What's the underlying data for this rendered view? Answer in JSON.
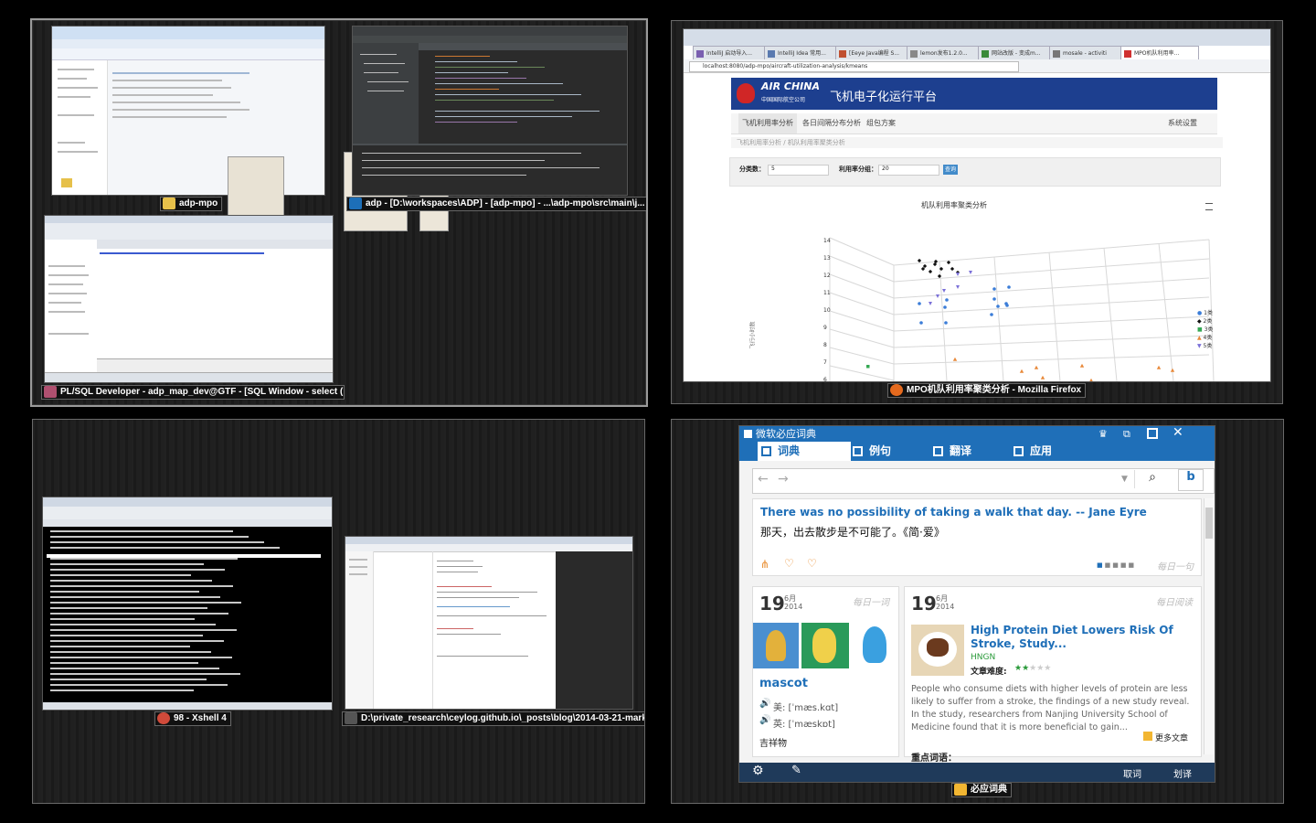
{
  "labels": {
    "explorer": "adp-mpo",
    "idea": "adp - [D:\\workspaces\\ADP] - [adp-mpo] - ...\\adp-mpo\\src\\main\\j...",
    "plsql": "PL/SQL Developer - adp_map_dev@GTF - [SQL Window - select (ma...",
    "firefox": "MPO机队利用率聚类分析 - Mozilla Firefox",
    "xshell": "98 - Xshell 4",
    "editor": "D:\\private_research\\ceylog.github.io\\_posts\\blog\\2014-03-21-mark-...",
    "dict": "必应词典"
  },
  "firefox": {
    "tabs": [
      "IntelliJ 启动导入...",
      "IntelliJ Idea 常用...",
      "[Eeye Java编程 S...",
      "lemon发布1.2.0...",
      "网站改版 - 变成m...",
      "mosale - activiti",
      "MPO机队利用率..."
    ],
    "url": "localhost:8080/adp-mpo/aircraft-utilization-analysis/kmeans",
    "airline": "AIR CHINA",
    "airline_cn": "中国国际航空公司",
    "platform": "飞机电子化运行平台",
    "nav": [
      "飞机利用率分析",
      "各日间隔分布分析",
      "组包方案"
    ],
    "settings": "系统设置",
    "breadcrumb": [
      "飞机利用率分析",
      "机队利用率聚类分析"
    ],
    "form": {
      "k_label": "分类数：",
      "k_value": "5",
      "group_label": "利用率分组：",
      "group_value": "20",
      "query": "查询"
    },
    "chart_title": "机队利用率聚类分析",
    "y_label": "飞行小时数",
    "y_ticks": [
      "14",
      "13",
      "12",
      "11",
      "10",
      "9",
      "8",
      "7",
      "6"
    ],
    "legend": [
      "1类",
      "2类",
      "3类",
      "4类",
      "5类"
    ]
  },
  "dict": {
    "app_title": "微软必应词典",
    "tabs": [
      "词典",
      "例句",
      "翻译",
      "应用"
    ],
    "sentence_en": "There was no possibility of taking a walk that day. -- Jane Eyre",
    "sentence_cn": "那天，出去散步是不可能了。《简·爱》",
    "daily_sentence": "每日一句",
    "left_card": {
      "day": "19",
      "month": "6月",
      "year": "2014",
      "tag": "每日一词",
      "word": "mascot",
      "us": "美: [ˈmæs.kɑt]",
      "uk": "英: [ˈmæskɒt]",
      "meaning": "吉祥物"
    },
    "right_card": {
      "day": "19",
      "month": "6月",
      "year": "2014",
      "tag": "每日阅读",
      "headline": "High Protein Diet Lowers Risk Of Stroke, Study...",
      "source": "HNGN",
      "difficulty": "文章难度:",
      "body": "People who consume diets with higher levels of protein are less likely to suffer from a stroke, the findings of a new study reveal. In the study, researchers from Nanjing University School of Medicine found that it is more beneficial to gain...",
      "more": "更多文章",
      "key_words": "重点词语："
    },
    "footer": [
      "取词",
      "划译"
    ]
  },
  "colors": {
    "firefox_brand": "#1d3f8f",
    "dict_blue": "#1f6fb8",
    "xshell_bg": "#000000"
  }
}
